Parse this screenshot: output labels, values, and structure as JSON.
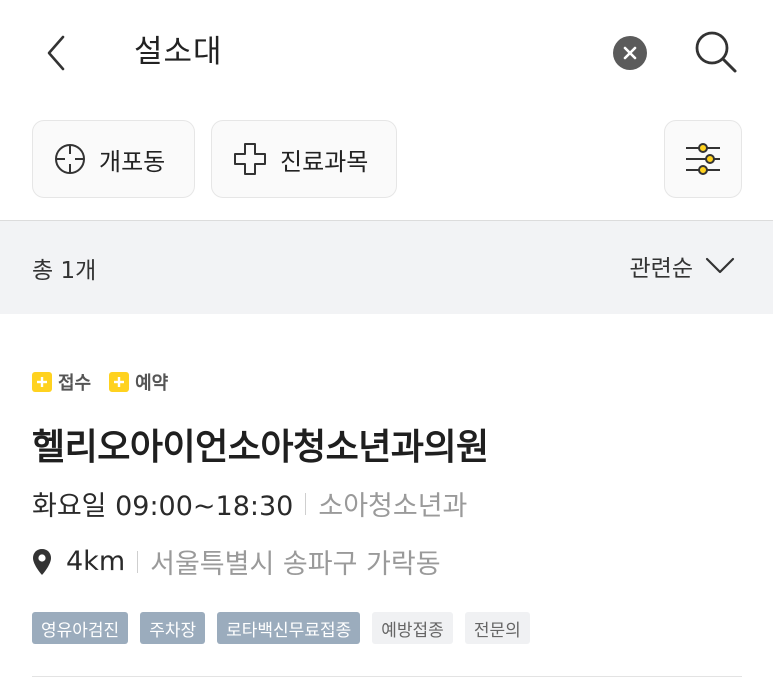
{
  "header": {
    "search_query": "설소대"
  },
  "filters": {
    "location_label": "개포동",
    "department_label": "진료과목"
  },
  "summary": {
    "total_label": "총 1개",
    "sort_label": "관련순"
  },
  "result": {
    "badges": [
      "접수",
      "예약"
    ],
    "name": "헬리오아이언소아청소년과의원",
    "hours": "화요일 09:00~18:30",
    "department": "소아청소년과",
    "distance": "4km",
    "address": "서울특별시 송파구 가락동",
    "tags": [
      {
        "label": "영유아검진",
        "style": "dark"
      },
      {
        "label": "주차장",
        "style": "dark"
      },
      {
        "label": "로타백신무료접종",
        "style": "dark"
      },
      {
        "label": "예방접종",
        "style": "light"
      },
      {
        "label": "전문의",
        "style": "light"
      }
    ]
  },
  "colors": {
    "badge_yellow": "#ffd21f",
    "tag_dark": "#9bacbd",
    "tag_light": "#f0f1f3",
    "summary_bg": "#f2f3f5"
  },
  "icons": {
    "back": "chevron-left-icon",
    "clear": "clear-circle-icon",
    "search": "search-icon",
    "location": "crosshair-icon",
    "department": "medical-cross-icon",
    "settings": "sliders-icon",
    "sort": "chevron-down-icon",
    "pin": "map-pin-icon"
  }
}
